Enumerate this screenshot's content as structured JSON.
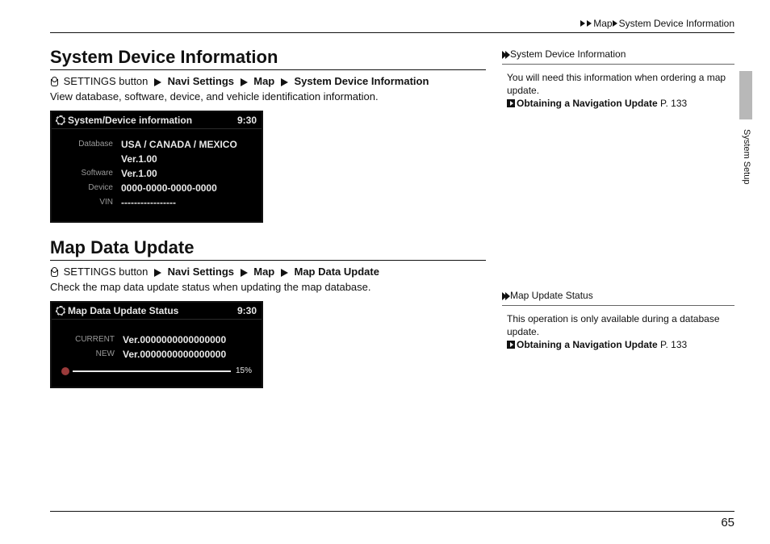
{
  "breadcrumb": {
    "a": "Map",
    "b": "System Device Information"
  },
  "section1": {
    "heading": "System Device Information",
    "path_prefix": "SETTINGS button",
    "path_items": [
      "Navi Settings",
      "Map",
      "System Device Information"
    ],
    "desc": "View database, software, device, and vehicle identification information.",
    "shot_title": "System/Device information",
    "clock": "9:30",
    "rows": [
      {
        "label": "Database",
        "value": "USA / CANADA / MEXICO"
      },
      {
        "label": "",
        "value": "Ver.1.00"
      },
      {
        "label": "Software",
        "value": "Ver.1.00"
      },
      {
        "label": "Device",
        "value": "0000-0000-0000-0000"
      },
      {
        "label": "VIN",
        "value": "-----------------"
      }
    ]
  },
  "section2": {
    "heading": "Map Data Update",
    "path_prefix": "SETTINGS button",
    "path_items": [
      "Navi Settings",
      "Map",
      "Map Data Update"
    ],
    "desc": "Check the map data update status when updating the map database.",
    "shot_title": "Map Data Update Status",
    "clock": "9:30",
    "rows": [
      {
        "label": "CURRENT",
        "value": "Ver.0000000000000000"
      },
      {
        "label": "NEW",
        "value": "Ver.0000000000000000"
      }
    ],
    "progress": "15%"
  },
  "side1": {
    "title": "System Device Information",
    "body": "You will need this information when ordering a map update.",
    "xref_text": "Obtaining a Navigation Update",
    "xref_page": "P. 133"
  },
  "side2": {
    "title": "Map Update Status",
    "body": "This operation is only available during a database update.",
    "xref_text": "Obtaining a Navigation Update",
    "xref_page": "P. 133"
  },
  "edge_label": "System Setup",
  "page_number": "65"
}
